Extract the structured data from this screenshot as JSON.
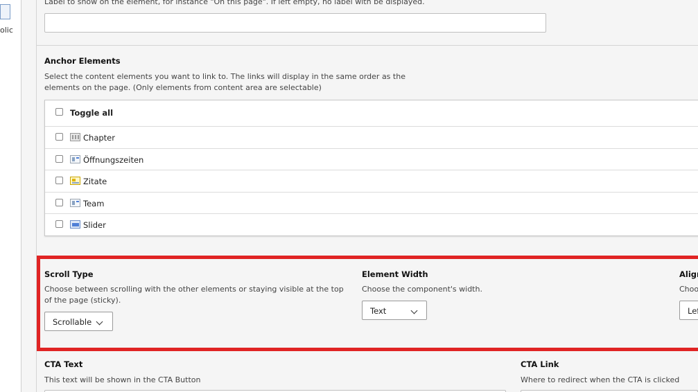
{
  "sidebar": {
    "partial_text": "olic"
  },
  "label_field": {
    "help": "Label to show on the element, for instance \"On this page\". If left empty, no label with be displayed.",
    "value": ""
  },
  "anchor_elements": {
    "title": "Anchor Elements",
    "help_line1": "Select the content elements you want to link to. The links will display in the same order as the",
    "help_line2": "elements on the page. (Only elements from content area are selectable)",
    "toggle_all": "Toggle all",
    "items": [
      {
        "label": "Chapter",
        "icon": "chapter-icon"
      },
      {
        "label": "Öffnungszeiten",
        "icon": "content-element-icon"
      },
      {
        "label": "Zitate",
        "icon": "quote-icon"
      },
      {
        "label": "Team",
        "icon": "content-element-icon"
      },
      {
        "label": "Slider",
        "icon": "slider-icon"
      }
    ]
  },
  "scroll_type": {
    "title": "Scroll Type",
    "help_line1": "Choose between scrolling with the other elements or staying visible at the top",
    "help_line2": "of the page (sticky).",
    "selected": "Scrollable"
  },
  "element_width": {
    "title": "Element Width",
    "help": "Choose the component's width.",
    "selected": "Text"
  },
  "alignment": {
    "title": "Align",
    "help": "Choo",
    "selected": "Lef"
  },
  "cta_text": {
    "title": "CTA Text",
    "help": "This text will be shown in the CTA Button"
  },
  "cta_link": {
    "title": "CTA Link",
    "help": "Where to redirect when the CTA is clicked"
  },
  "colors": {
    "highlight": "#e02424",
    "input_border": "#bfbfbf",
    "background": "#f5f5f5"
  }
}
